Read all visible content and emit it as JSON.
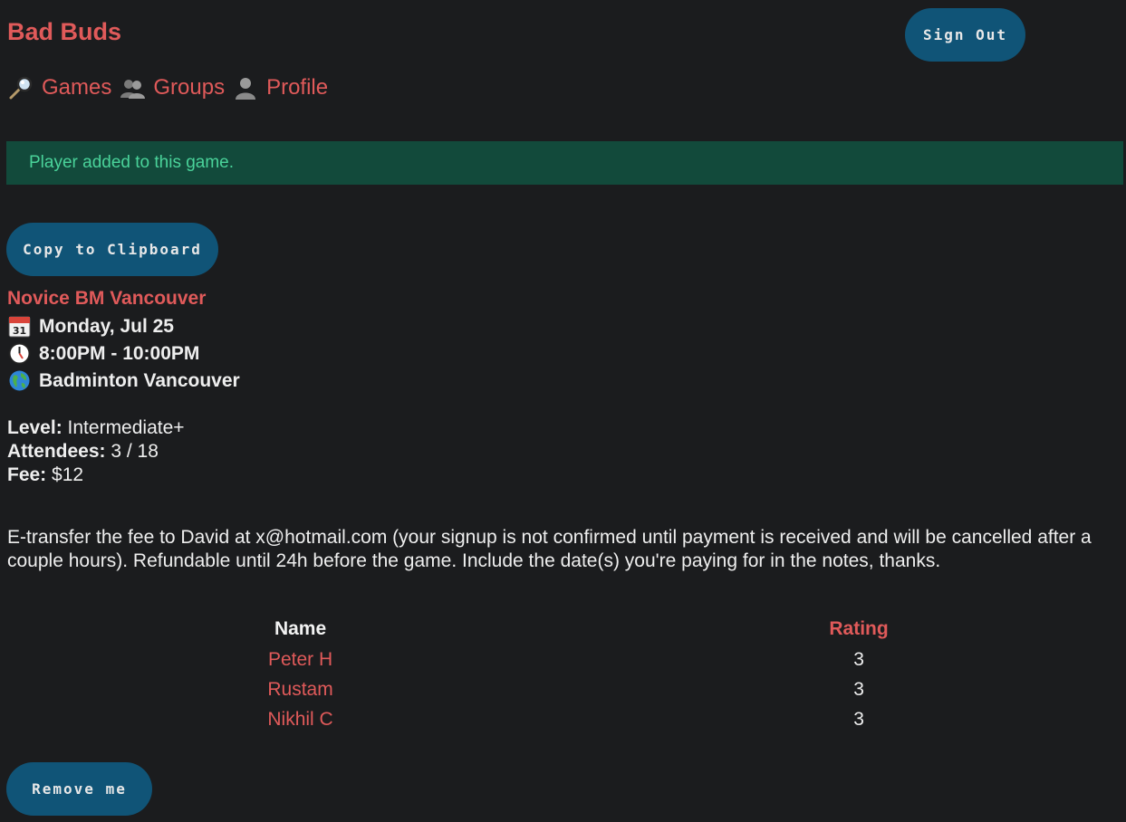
{
  "app": {
    "title": "Bad Buds"
  },
  "header": {
    "sign_out_label": "Sign Out"
  },
  "nav": {
    "items": [
      {
        "label": "Games",
        "icon": "magnifier-icon"
      },
      {
        "label": "Groups",
        "icon": "people-icon"
      },
      {
        "label": "Profile",
        "icon": "person-icon"
      }
    ]
  },
  "alert": {
    "message": "Player added to this game.",
    "color": "#4ad39a",
    "background": "#124a3b"
  },
  "actions": {
    "copy_label": "Copy to Clipboard",
    "remove_label": "Remove me"
  },
  "game": {
    "title": "Novice BM Vancouver",
    "date": "Monday, Jul 25",
    "time": "8:00PM - 10:00PM",
    "location": "Badminton Vancouver",
    "level_label": "Level:",
    "level": "Intermediate+",
    "attendees_label": "Attendees:",
    "attendees": "3 / 18",
    "fee_label": "Fee:",
    "fee": "$12",
    "notes": "E-transfer the fee to David at x@hotmail.com (your signup is not confirmed until payment is received and will be cancelled after a couple hours). Refundable until 24h before the game. Include the date(s) you're paying for in the notes, thanks."
  },
  "roster": {
    "headers": {
      "name": "Name",
      "rating": "Rating"
    },
    "rows": [
      {
        "name": "Peter H",
        "rating": "3"
      },
      {
        "name": "Rustam",
        "rating": "3"
      },
      {
        "name": "Nikhil C",
        "rating": "3"
      }
    ]
  },
  "colors": {
    "accent": "#e05a5a",
    "button": "#105477",
    "background": "#1b1c1e"
  }
}
